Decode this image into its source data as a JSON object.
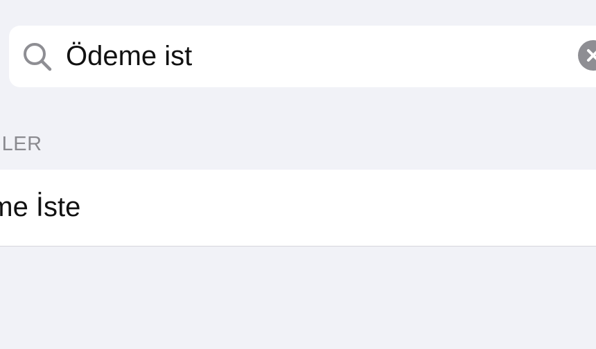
{
  "search": {
    "value": "Ödeme ist"
  },
  "icons": {
    "search": "search-icon",
    "clear": "clear-x-icon"
  },
  "results": {
    "section_header": "MLER",
    "items": [
      {
        "label": "eme İste"
      }
    ]
  },
  "colors": {
    "background": "#f1f2f7",
    "card": "#ffffff",
    "clear_button": "#8e8e93",
    "section_header_text": "#8a8a8f"
  }
}
